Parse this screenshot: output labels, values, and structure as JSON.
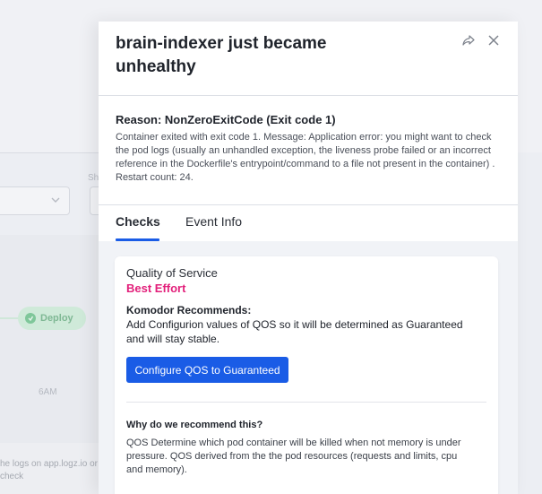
{
  "background": {
    "select_label_fragment": "Sh",
    "deploy_label": "Deploy",
    "time_label": "6AM",
    "logs_text": "he logs on app.logz.io or check"
  },
  "drawer": {
    "title": "brain-indexer just became unhealthy",
    "reason_title": "Reason: NonZeroExitCode (Exit code 1)",
    "reason_text": "Container exited with exit code 1. Message: Application error: you might want to check the pod logs (usually an unhandled exception, the liveness probe failed or an incorrect reference in the Dockerfile's entrypoint/command to a file not present in the container) . Restart count: 24.",
    "tabs": [
      {
        "label": "Checks",
        "active": true
      },
      {
        "label": "Event Info",
        "active": false
      }
    ],
    "icons": {
      "share": "share-icon",
      "close": "close-icon"
    }
  },
  "card": {
    "qos_label": "Quality of Service",
    "qos_value": "Best Effort",
    "rec_title": "Komodor Recommends:",
    "rec_text": "Add Configurion values of QOS so it will be determined as Guaranteed and will stay stable.",
    "cta_label": "Configure QOS to Guaranteed",
    "why_title": "Why do we recommend this?",
    "why_text": "QOS Determine which pod container will be killed when not memory is under pressure. QOS derived from the the pod resources (requests and limits, cpu and memory)."
  },
  "colors": {
    "accent": "#1a5ce6",
    "qos_value": "#e21f7a",
    "deploy_green": "#7fc79a"
  }
}
